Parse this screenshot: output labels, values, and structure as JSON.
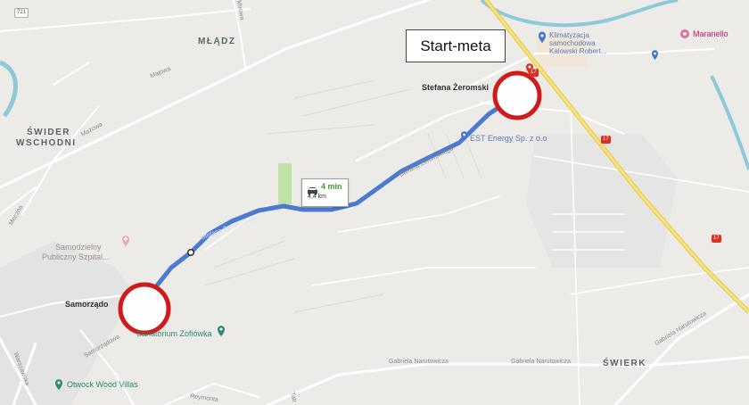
{
  "map": {
    "districts": {
      "mladz": "MŁĄDZ",
      "swider_line1": "ŚWIDER",
      "swider_line2": "WSCHODNI",
      "swierk": "ŚWIERK"
    },
    "places": {
      "stefana": "Stefana Żeromski",
      "samorzad": "Samorządo"
    },
    "pois": {
      "klimatyzacja_line1": "Klimatyzacja",
      "klimatyzacja_line2": "samochodowa",
      "klimatyzacja_line3": "Kalowski Robert...",
      "maranello": "Maranello",
      "energy": "EST Energy Sp. z o.o",
      "szpital_line1": "Samodzielny",
      "szpital_line2": "Publiczny Szpital...",
      "sanatorium": "Sanatorium Zofiówka",
      "otwock": "Otwock Wood Villas"
    },
    "streets": {
      "mirowa": "Mirowa",
      "majowa": "Majowa",
      "mazowa": "Mazowa",
      "moczna": "Moczna",
      "samorzadowa": "Samorządowa",
      "warszawska": "Warszawska",
      "reymonta": "Reymonta",
      "narutowicza_1": "Gabriela Narutowicza",
      "narutowicza_2": "Gabriela Narutowicza",
      "narutowicza_3": "Gabriela Narutowicza",
      "zeromskiego": "Stefana Żeromskiego",
      "route_road": "Stefana Żeromskiego",
      "tatr": "Tatr"
    },
    "shields": {
      "r721": "721",
      "r17a": "17",
      "r17b": "17",
      "r17c": "17"
    },
    "route": {
      "duration": "4 min",
      "distance": "4,4 km"
    },
    "annotation": "Start-meta",
    "colors": {
      "route": "#4a7bd0",
      "marker_ring": "#d11a1a",
      "highway": "#f7e27c",
      "land": "#ecebe8",
      "water": "#8ec9d8",
      "duration": "#3a9a2e"
    },
    "icons": [
      "car-icon",
      "pin-icon",
      "heart-icon",
      "hospital-icon",
      "star-icon"
    ]
  }
}
